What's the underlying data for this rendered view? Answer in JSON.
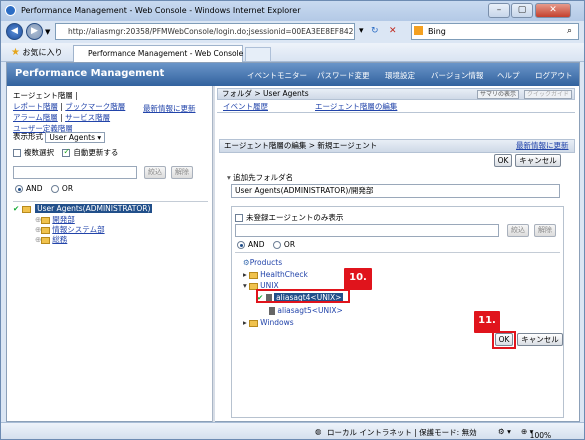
{
  "window": {
    "title": "Performance Management - Web Console - Windows Internet Explorer",
    "url": "http://aliasmgr:20358/PFMWebConsole/login.do;jsessionid=00EA3EE8EF842",
    "search_engine": "Bing",
    "favorites_label": "お気に入り",
    "tab_title": "Performance Management - Web Console"
  },
  "header": {
    "brand": "Performance Management",
    "menu": [
      "イベントモニター",
      "パスワード変更",
      "環境設定",
      "バージョン情報",
      "ヘルプ",
      "ログアウト"
    ]
  },
  "left": {
    "links_row1": "エージェント階層",
    "links_row2a": "レポート階層",
    "links_row2b": "ブックマーク階層",
    "links_row3a": "アラーム階層",
    "links_row3b": "サービス階層",
    "links_row4": "ユーザー定義階層",
    "refresh": "最新情報に更新",
    "display_label": "表示形式",
    "display_value": "User Agents",
    "multi_select": "複数選択",
    "auto_update": "自動更新する",
    "filter_btn": "絞込",
    "clear_btn": "解除",
    "and_label": "AND",
    "or_label": "OR",
    "tree_root": "User Agents(ADMINISTRATOR)",
    "tree_children": [
      "開発部",
      "情報システム部",
      "総務"
    ]
  },
  "right": {
    "folder_crumb": "フォルダ > User Agents",
    "summary_btn": "サマリの表示",
    "quick_guide_btn": "クイックガイド",
    "event_history": "イベント履歴",
    "edit_hierarchy": "エージェント階層の編集",
    "section_title": "エージェント階層の編集 > 新規エージェント",
    "refresh": "最新情報に更新",
    "ok": "OK",
    "cancel": "キャンセル",
    "add_folder_label": "追加先フォルダ名",
    "folder_value": "User Agents(ADMINISTRATOR)/開発部",
    "unregistered_only": "未登録エージェントのみ表示",
    "filter_btn": "絞込",
    "clear_btn": "解除",
    "and_label": "AND",
    "or_label": "OR",
    "tree": {
      "root": "Products",
      "healthcheck": "HealthCheck",
      "unix": "UNIX",
      "agent_selected": "aliasagt4<UNIX>",
      "agent_other": "aliasagt5<UNIX>",
      "windows": "Windows"
    },
    "step10": "10.",
    "step11": "11."
  },
  "status": {
    "zone": "ローカル イントラネット | 保護モード: 無効",
    "zoom": "100%"
  },
  "colors": {
    "header": "#32629e",
    "callout": "#e0141c",
    "link": "#2244aa",
    "selected": "#214f8a"
  }
}
